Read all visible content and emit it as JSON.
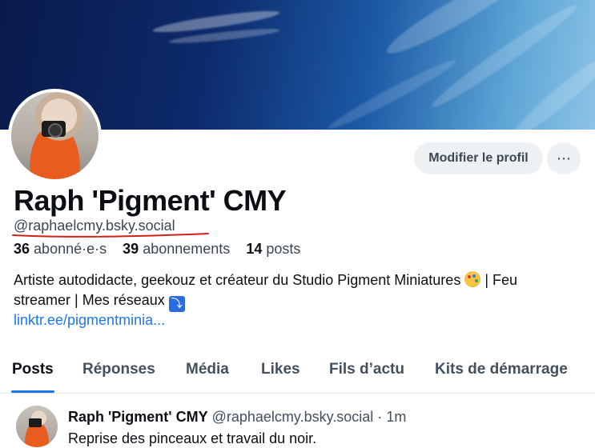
{
  "profile": {
    "display_name": "Raph 'Pigment' CMY",
    "handle": "@raphaelcmy.bsky.social",
    "followers_count": "36",
    "followers_label": "abonné·e·s",
    "following_count": "39",
    "following_label": "abonnements",
    "posts_count": "14",
    "posts_label": "posts",
    "bio_line1": "Artiste autodidacte, geekouz et créateur du Studio Pigment Miniatures",
    "bio_line1_after": " | Feu",
    "bio_line2": "streamer | Mes réseaux",
    "link": "linktr.ee/pigmentminia..."
  },
  "actions": {
    "edit_profile_label": "Modifier le profil",
    "more_label": "⋯"
  },
  "tabs": [
    {
      "label": "Posts",
      "active": true
    },
    {
      "label": "Réponses",
      "active": false
    },
    {
      "label": "Média",
      "active": false
    },
    {
      "label": "Likes",
      "active": false
    },
    {
      "label": "Fils d’actu",
      "active": false
    },
    {
      "label": "Kits de démarrage",
      "active": false
    }
  ],
  "post": {
    "author_name": "Raph 'Pigment' CMY",
    "author_handle": "@raphaelcmy.bsky.social",
    "separator": "·",
    "time": "1m",
    "text": "Reprise des pinceaux et travail du noir."
  },
  "icons": {
    "palette": "palette-emoji",
    "down_arrow": "down-arrow-key-emoji",
    "more": "ellipsis-icon"
  },
  "colors": {
    "accent": "#1c78e8",
    "underline_annotation": "#d0211c"
  }
}
